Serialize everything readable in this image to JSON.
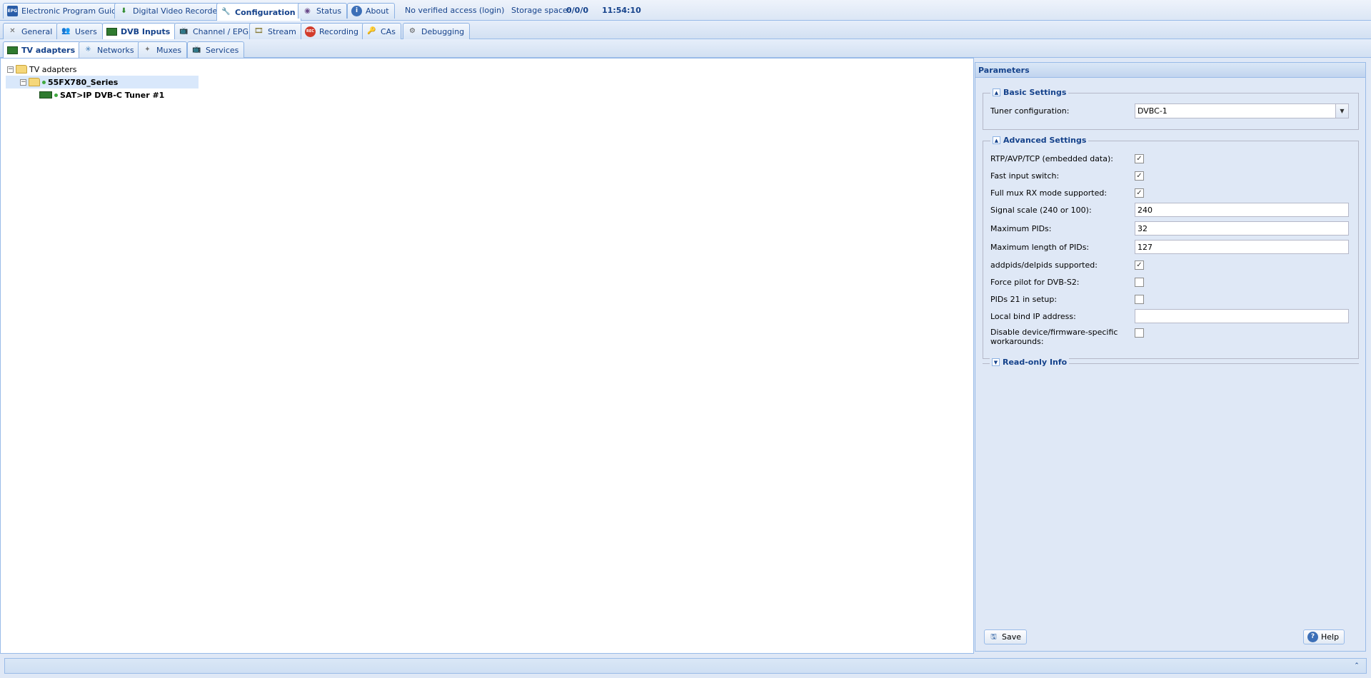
{
  "top_tabs": [
    {
      "label": "Electronic Program Guide",
      "icon": "epg-icon"
    },
    {
      "label": "Digital Video Recorder",
      "icon": "download-icon"
    },
    {
      "label": "Configuration",
      "icon": "wrench-icon"
    },
    {
      "label": "Status",
      "icon": "eye-icon"
    },
    {
      "label": "About",
      "icon": "info-icon"
    }
  ],
  "access_text": "No verified access",
  "login_text": "(login)",
  "storage_label": "Storage space:",
  "storage_value": "0/0/0",
  "clock": "11:54:10",
  "config_tabs": [
    {
      "label": "General"
    },
    {
      "label": "Users"
    },
    {
      "label": "DVB Inputs"
    },
    {
      "label": "Channel / EPG"
    },
    {
      "label": "Stream"
    },
    {
      "label": "Recording"
    },
    {
      "label": "CAs"
    },
    {
      "label": "Debugging"
    }
  ],
  "dvb_tabs": [
    {
      "label": "TV adapters"
    },
    {
      "label": "Networks"
    },
    {
      "label": "Muxes"
    },
    {
      "label": "Services"
    }
  ],
  "tree": {
    "root": "TV adapters",
    "device": "55FX780_Series",
    "tuner": "SAT>IP DVB-C Tuner #1"
  },
  "params": {
    "title": "Parameters",
    "basic_legend": "Basic Settings",
    "tuner_label": "Tuner configuration:",
    "tuner_value": "DVBC-1",
    "advanced_legend": "Advanced Settings",
    "rtp_label": "RTP/AVP/TCP (embedded data):",
    "fast_label": "Fast input switch:",
    "fullmux_label": "Full mux RX mode supported:",
    "signal_label": "Signal scale (240 or 100):",
    "signal_value": "240",
    "maxpids_label": "Maximum PIDs:",
    "maxpids_value": "32",
    "maxlen_label": "Maximum length of PIDs:",
    "maxlen_value": "127",
    "addpids_label": "addpids/delpids supported:",
    "pilot_label": "Force pilot for DVB-S2:",
    "pids21_label": "PIDs 21 in setup:",
    "bind_label": "Local bind IP address:",
    "bind_value": "",
    "disable_label": "Disable device/firmware-specific workarounds:",
    "readonly_legend": "Read-only Info",
    "save_label": "Save",
    "help_label": "Help"
  }
}
